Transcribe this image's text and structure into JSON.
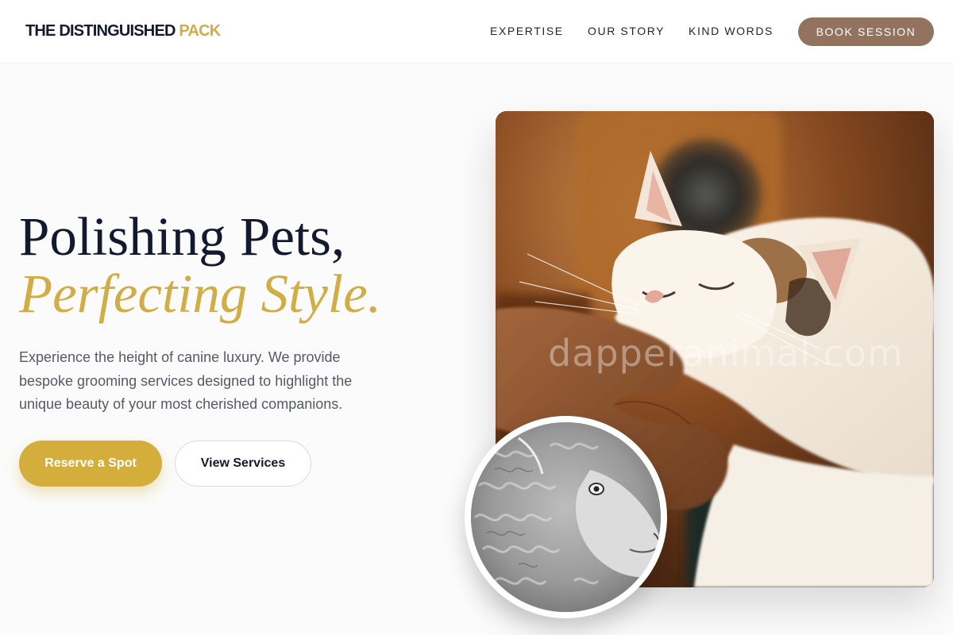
{
  "header": {
    "logo_main": "THE DISTINGUISHED",
    "logo_accent": "PACK",
    "nav": [
      "EXPERTISE",
      "OUR STORY",
      "KIND WORDS"
    ],
    "cta": "BOOK SESSION"
  },
  "hero": {
    "title_line1": "Polishing Pets,",
    "title_line2": "Perfecting Style.",
    "description": "Experience the height of canine luxury. We provide bespoke grooming services designed to highlight the unique beauty of your most cherished companions.",
    "primary_button": "Reserve a Spot",
    "secondary_button": "View Services"
  },
  "images": {
    "main_alt": "Calico cat being petted under the chin",
    "main_watermark": "dapperanimal.com",
    "circle_alt": "Black and white photo of a curly-fleeced sheep"
  },
  "colors": {
    "accent_gold": "#d0ae45",
    "button_gold": "#d4ae3c",
    "nav_button_brown": "#93735e",
    "heading_navy": "#141a2e"
  }
}
